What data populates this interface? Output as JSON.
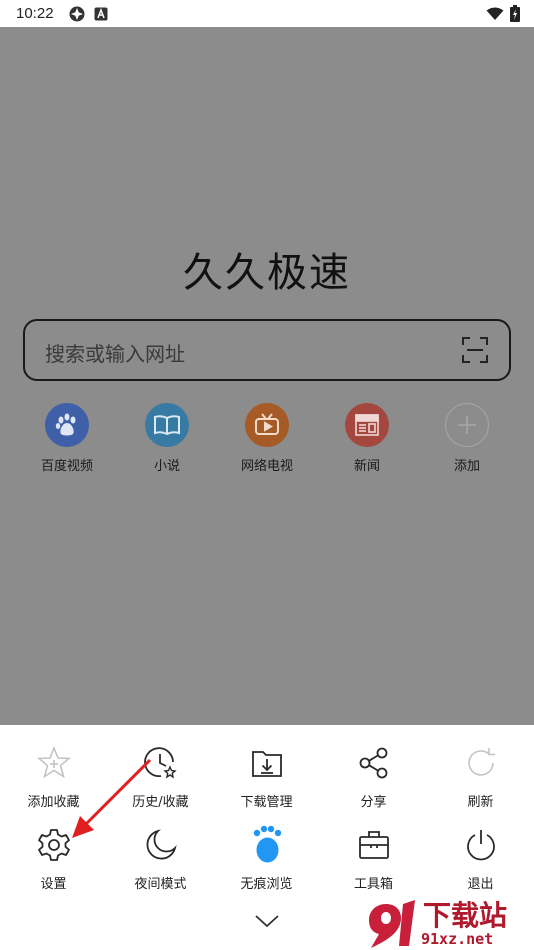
{
  "status_bar": {
    "time": "10:22"
  },
  "home": {
    "title": "久久极速",
    "search": {
      "placeholder": "搜索或输入网址"
    },
    "shortcuts": [
      {
        "label": "百度视频",
        "icon": "baidu-paw-icon",
        "color": "#3f6fd0"
      },
      {
        "label": "小说",
        "icon": "book-icon",
        "color": "#3a8fc5"
      },
      {
        "label": "网络电视",
        "icon": "tv-icon",
        "color": "#e0661d"
      },
      {
        "label": "新闻",
        "icon": "news-icon",
        "color": "#d6452e"
      },
      {
        "label": "添加",
        "icon": "plus-icon",
        "color": "#9a9a9a"
      }
    ]
  },
  "menu": {
    "items": [
      {
        "label": "添加收藏",
        "icon": "star-add-icon",
        "enabled": false
      },
      {
        "label": "历史/收藏",
        "icon": "history-icon",
        "enabled": true
      },
      {
        "label": "下载管理",
        "icon": "download-folder-icon",
        "enabled": true
      },
      {
        "label": "分享",
        "icon": "share-icon",
        "enabled": true
      },
      {
        "label": "刷新",
        "icon": "refresh-icon",
        "enabled": false
      },
      {
        "label": "设置",
        "icon": "gear-icon",
        "enabled": true
      },
      {
        "label": "夜间模式",
        "icon": "moon-icon",
        "enabled": true
      },
      {
        "label": "无痕浏览",
        "icon": "incognito-paw-icon",
        "enabled": true,
        "accent": "#2196f3"
      },
      {
        "label": "工具箱",
        "icon": "toolbox-icon",
        "enabled": true
      },
      {
        "label": "退出",
        "icon": "power-icon",
        "enabled": true
      }
    ]
  },
  "watermark": {
    "logo_text": "下载站",
    "url": "91xz.net"
  },
  "colors": {
    "overlay": "#8c8c8c",
    "annotation_arrow": "#e02020",
    "watermark": "#b0182b"
  }
}
